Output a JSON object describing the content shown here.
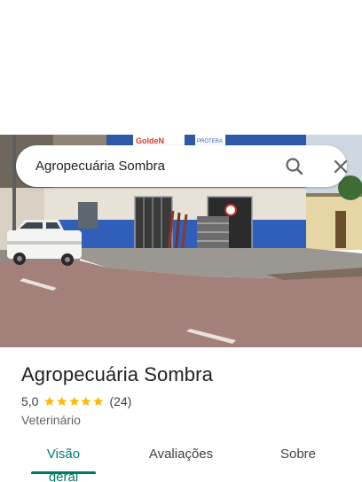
{
  "search": {
    "query": "Agropecuária Sombra",
    "search_icon": "search-icon",
    "close_icon": "close-icon"
  },
  "photo": {
    "sign_brand": "GoldeN",
    "sign_text": "PROTERA"
  },
  "place": {
    "name": "Agropecuária Sombra",
    "rating": "5,0",
    "stars": 5,
    "reviews": "(24)",
    "category": "Veterinário"
  },
  "tabs": [
    {
      "label": "Visão geral",
      "active": true
    },
    {
      "label": "Avaliações",
      "active": false
    },
    {
      "label": "Sobre",
      "active": false
    }
  ],
  "colors": {
    "accent": "#00796b",
    "star": "#fbbc04"
  }
}
